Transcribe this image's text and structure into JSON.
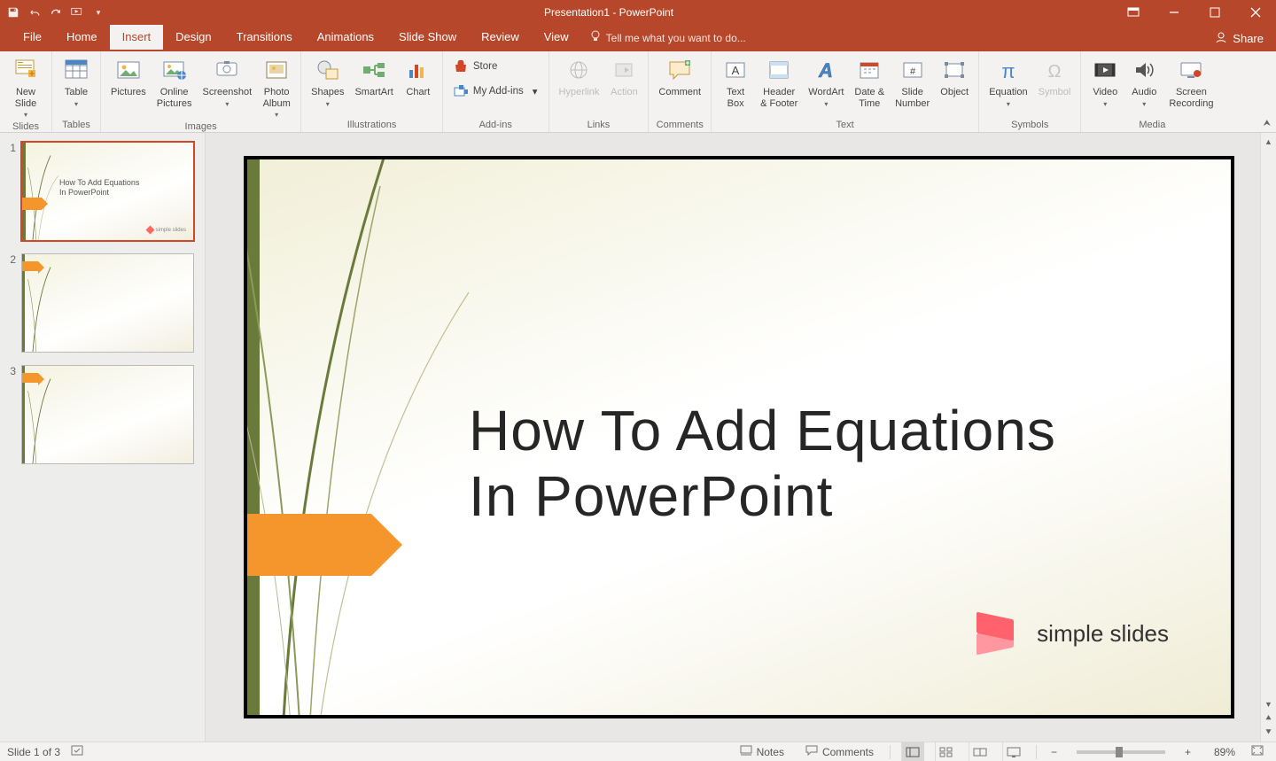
{
  "app": {
    "title": "Presentation1 - PowerPoint"
  },
  "qat": {
    "save": "Save",
    "undo": "Undo",
    "redo": "Redo",
    "start": "Start From Beginning"
  },
  "win": {
    "displayopts": "Ribbon Display Options",
    "min": "Minimize",
    "max": "Restore Down",
    "close": "Close"
  },
  "tabs": {
    "file": "File",
    "items": [
      "Home",
      "Insert",
      "Design",
      "Transitions",
      "Animations",
      "Slide Show",
      "Review",
      "View"
    ],
    "activeIndex": 1,
    "tellme_placeholder": "Tell me what you want to do...",
    "share": "Share"
  },
  "ribbon": {
    "groups": {
      "slides": {
        "label": "Slides",
        "newSlide": "New\nSlide"
      },
      "tables": {
        "label": "Tables",
        "table": "Table"
      },
      "images": {
        "label": "Images",
        "pictures": "Pictures",
        "online": "Online\nPictures",
        "screenshot": "Screenshot",
        "album": "Photo\nAlbum"
      },
      "illustrations": {
        "label": "Illustrations",
        "shapes": "Shapes",
        "smartart": "SmartArt",
        "chart": "Chart"
      },
      "addins": {
        "label": "Add-ins",
        "store": "Store",
        "myaddins": "My Add-ins"
      },
      "links": {
        "label": "Links",
        "hyperlink": "Hyperlink",
        "action": "Action"
      },
      "comments": {
        "label": "Comments",
        "comment": "Comment"
      },
      "text": {
        "label": "Text",
        "textbox": "Text\nBox",
        "headerfooter": "Header\n& Footer",
        "wordart": "WordArt",
        "datetime": "Date &\nTime",
        "slidenumber": "Slide\nNumber",
        "object": "Object"
      },
      "symbols": {
        "label": "Symbols",
        "equation": "Equation",
        "symbol": "Symbol"
      },
      "media": {
        "label": "Media",
        "video": "Video",
        "audio": "Audio",
        "screenrec": "Screen\nRecording"
      }
    }
  },
  "thumbs": {
    "count": 3,
    "selected": 1,
    "slide1_title": "How To Add Equations\nIn PowerPoint",
    "slide1_brand": "simple slides"
  },
  "slide": {
    "title": "How To Add Equations In PowerPoint",
    "brand": "simple slides"
  },
  "status": {
    "slide_of": "Slide 1 of 3",
    "notes": "Notes",
    "comments": "Comments",
    "zoom_pct": "89%",
    "zoom_out": "−",
    "zoom_in": "+"
  }
}
